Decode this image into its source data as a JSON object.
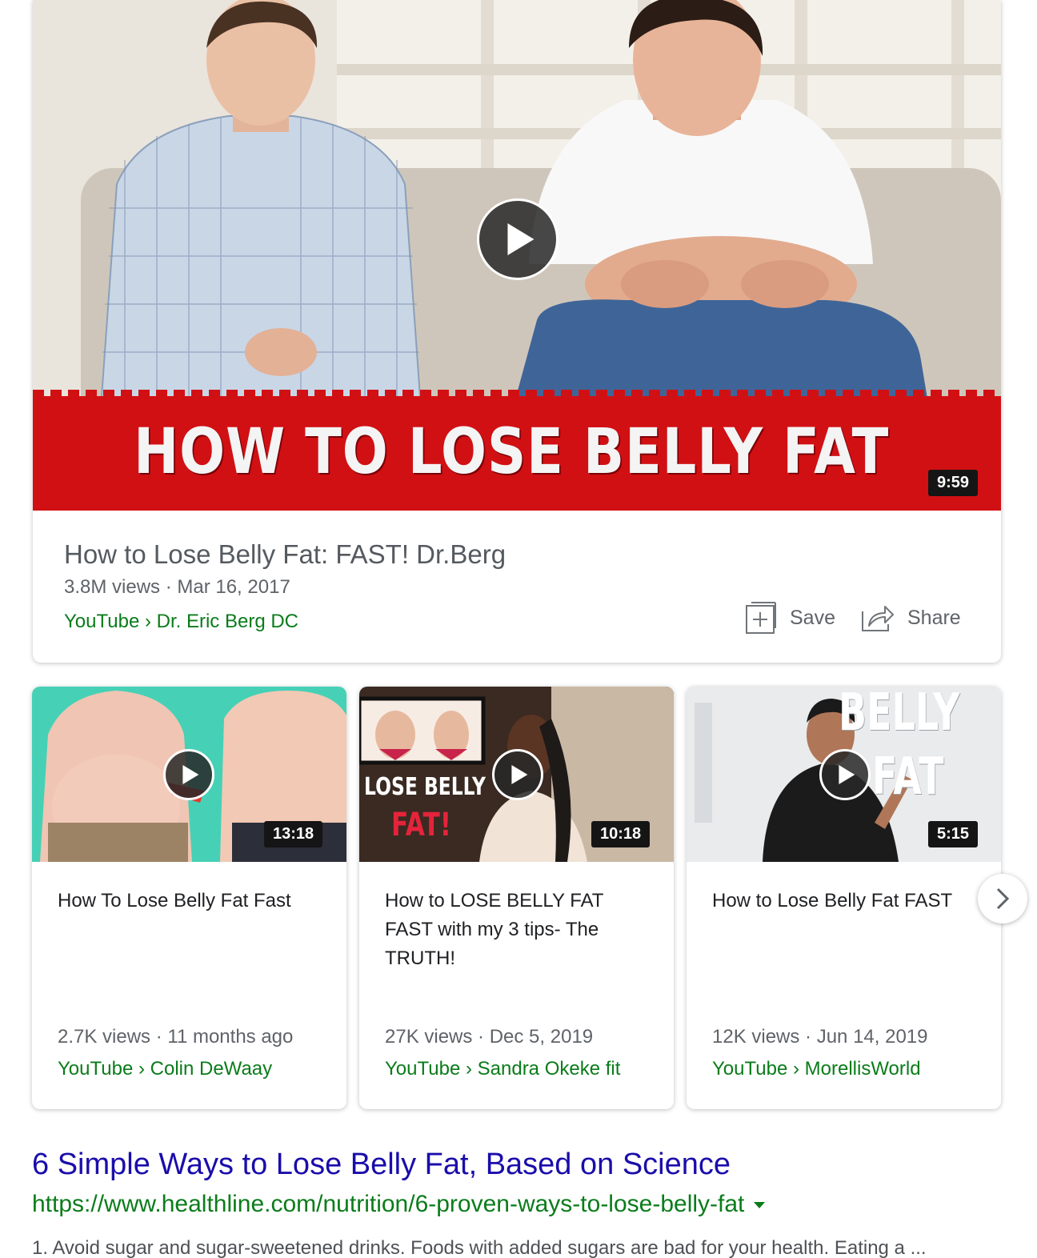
{
  "featured": {
    "thumbnail_text": "HOW TO LOSE BELLY FAT",
    "duration": "9:59",
    "title": "How to Lose Belly Fat: FAST! Dr.Berg",
    "meta": "3.8M views · Mar 16, 2017",
    "source": "YouTube › Dr. Eric Berg DC",
    "save_label": "Save",
    "share_label": "Share"
  },
  "videos": [
    {
      "duration": "13:18",
      "title": "How To Lose Belly Fat Fast",
      "meta": "2.7K views · 11 months ago",
      "source": "YouTube › Colin DeWaay"
    },
    {
      "duration": "10:18",
      "thumbnail_text_1": "LOSE BELLY",
      "thumbnail_text_2": "FAT!",
      "title": "How to LOSE BELLY FAT FAST with my 3 tips- The TRUTH!",
      "meta": "27K views · Dec 5, 2019",
      "source": "YouTube › Sandra Okeke fit"
    },
    {
      "duration": "5:15",
      "thumbnail_text_1": "BELLY",
      "thumbnail_text_2": "FAT",
      "title": "How to Lose Belly Fat FAST",
      "meta": "12K views · Jun 14, 2019",
      "source": "YouTube › MorellisWorld"
    }
  ],
  "result": {
    "title": "6 Simple Ways to Lose Belly Fat, Based on Science",
    "url": "https://www.healthline.com/nutrition/6-proven-ways-to-lose-belly-fat",
    "snippet": "1. Avoid sugar and sugar-sweetened drinks. Foods with added sugars are bad for your health. Eating a ..."
  },
  "colors": {
    "link": "#1a0dab",
    "source_green": "#0a7c1a",
    "thumbnail_red": "#d11014"
  }
}
